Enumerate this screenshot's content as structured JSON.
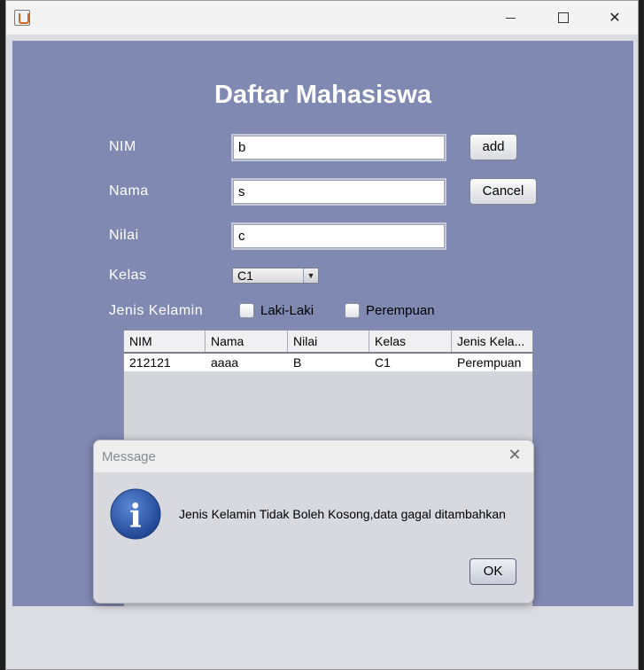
{
  "window": {
    "minimize_glyph": "",
    "maximize_glyph": "",
    "close_glyph": "✕"
  },
  "form": {
    "title": "Daftar Mahasiswa",
    "nim_label": "NIM",
    "nim_value": "b",
    "nama_label": "Nama",
    "nama_value": "s",
    "nilai_label": "Nilai",
    "nilai_value": "c",
    "kelas_label": "Kelas",
    "kelas_selected": "C1",
    "jenis_label": "Jenis Kelamin",
    "laki_label": "Laki-Laki",
    "perempuan_label": "Perempuan",
    "add_label": "add",
    "cancel_label": "Cancel"
  },
  "table": {
    "headers": [
      "NIM",
      "Nama",
      "Nilai",
      "Kelas",
      "Jenis Kela..."
    ],
    "rows": [
      [
        "212121",
        "aaaa",
        "B",
        "C1",
        "Perempuan"
      ]
    ]
  },
  "dialog": {
    "title": "Message",
    "close_glyph": "✕",
    "message": "Jenis Kelamin Tidak Boleh Kosong,data gagal ditambahkan",
    "ok_label": "OK",
    "icon_letter": "i"
  },
  "colors": {
    "panel_bg": "#8089b2",
    "title_text": "#ffffff",
    "info_icon": "#2b5aa8"
  }
}
